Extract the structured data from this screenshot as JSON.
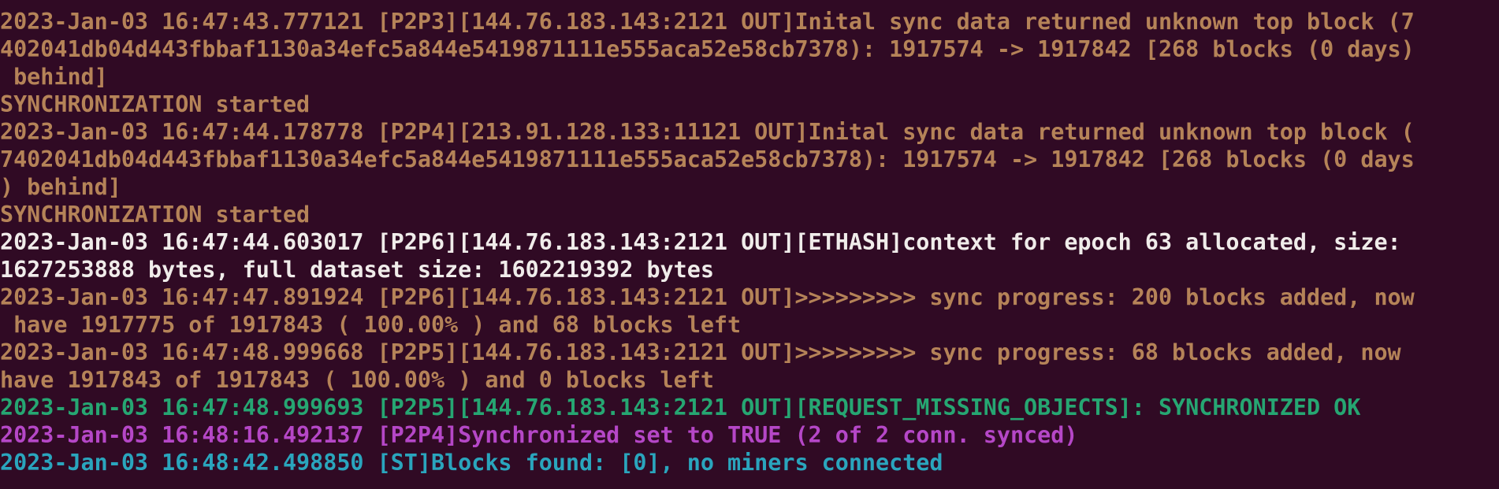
{
  "terminal": {
    "lines": [
      {
        "text": "2023-Jan-03 16:47:43.777121 [P2P3][144.76.183.143:2121 OUT]Inital sync data returned unknown top block (7",
        "color": "#b58358"
      },
      {
        "text": "402041db04d443fbbaf1130a34efc5a844e5419871111e555aca52e58cb7378): 1917574 -> 1917842 [268 blocks (0 days)",
        "color": "#b58358"
      },
      {
        "text": " behind]",
        "color": "#b58358"
      },
      {
        "text": "SYNCHRONIZATION started",
        "color": "#b58358"
      },
      {
        "text": "2023-Jan-03 16:47:44.178778 [P2P4][213.91.128.133:11121 OUT]Inital sync data returned unknown top block (",
        "color": "#b58358"
      },
      {
        "text": "7402041db04d443fbbaf1130a34efc5a844e5419871111e555aca52e58cb7378): 1917574 -> 1917842 [268 blocks (0 days",
        "color": "#b58358"
      },
      {
        "text": ") behind]",
        "color": "#b58358"
      },
      {
        "text": "SYNCHRONIZATION started",
        "color": "#b58358"
      },
      {
        "text": "2023-Jan-03 16:47:44.603017 [P2P6][144.76.183.143:2121 OUT][ETHASH]context for epoch 63 allocated, size:",
        "color": "#f0ecea"
      },
      {
        "text": "1627253888 bytes, full dataset size: 1602219392 bytes",
        "color": "#f0ecea"
      },
      {
        "text": "2023-Jan-03 16:47:47.891924 [P2P6][144.76.183.143:2121 OUT]>>>>>>>>> sync progress: 200 blocks added, now",
        "color": "#b58358"
      },
      {
        "text": " have 1917775 of 1917843 ( 100.00% ) and 68 blocks left",
        "color": "#b58358"
      },
      {
        "text": "2023-Jan-03 16:47:48.999668 [P2P5][144.76.183.143:2121 OUT]>>>>>>>>> sync progress: 68 blocks added, now",
        "color": "#b58358"
      },
      {
        "text": "have 1917843 of 1917843 ( 100.00% ) and 0 blocks left",
        "color": "#b58358"
      },
      {
        "text": "2023-Jan-03 16:47:48.999693 [P2P5][144.76.183.143:2121 OUT][REQUEST_MISSING_OBJECTS]: SYNCHRONIZED OK",
        "color": "#26a672"
      },
      {
        "text": "2023-Jan-03 16:48:16.492137 [P2P4]Synchronized set to TRUE (2 of 2 conn. synced)",
        "color": "#b547c7"
      },
      {
        "text": "2023-Jan-03 16:48:42.498850 [ST]Blocks found: [0], no miners connected",
        "color": "#2aa5bd"
      }
    ]
  },
  "colors": {
    "background": "#300a24",
    "log_info": "#b58358",
    "log_highlight": "#f0ecea",
    "log_success": "#26a672",
    "log_sync": "#b547c7",
    "log_stats": "#2aa5bd"
  }
}
